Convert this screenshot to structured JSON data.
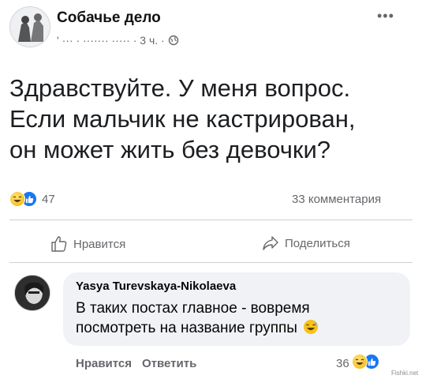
{
  "post": {
    "group_name": "Собачье дело",
    "meta_author_blurred": "' ··· ·  ·······  ·····",
    "meta_time": "· 3 ч. ·",
    "text_lines": [
      "Здравствуйте. У меня вопрос.",
      "Если мальчик не кастрирован,",
      "он может жить без девочки?"
    ],
    "reaction_count": "47",
    "comments_count": "33 комментария"
  },
  "actions": {
    "like_label": "Нравится",
    "share_label": "Поделиться"
  },
  "comment": {
    "author": "Yasya Turevskaya-Nikolaeva",
    "text_lines": [
      "В таких постах главное - вовремя",
      "посмотреть на название группы"
    ],
    "like_label": "Нравится",
    "reply_label": "Ответить",
    "reaction_count": "36"
  },
  "watermark": "Fishki.net",
  "colors": {
    "accent": "#1877f2",
    "muted": "#65676b",
    "bubble": "#f0f2f5"
  }
}
